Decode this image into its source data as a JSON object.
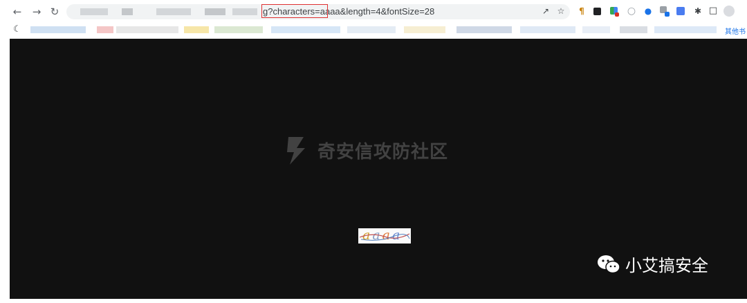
{
  "toolbar": {
    "url_visible": "g?characters=aaaa&length=4&fontSize=28",
    "icons": [
      "back-icon",
      "forward-icon",
      "reload-icon",
      "share-icon",
      "bookmark-star-icon",
      "extension-icons",
      "puzzle-icon",
      "sidepanel-icon",
      "profile-icon"
    ]
  },
  "bookmarks": {
    "more_label": "其他书"
  },
  "page": {
    "watermark": "奇安信攻防社区",
    "captcha_chars": [
      "a",
      "a",
      "a",
      "a"
    ]
  },
  "overlay": {
    "wechat_label": "小艾搞安全"
  }
}
